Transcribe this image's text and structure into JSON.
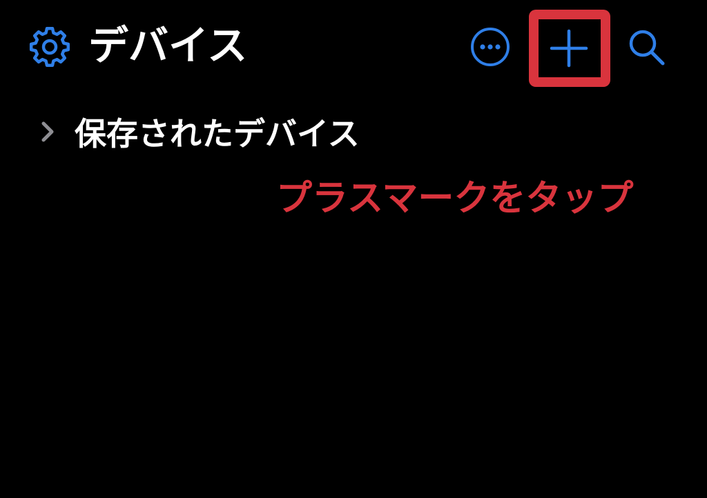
{
  "header": {
    "title": "デバイス",
    "icons": {
      "settings": "gear-icon",
      "more": "ellipsis-circle-icon",
      "add": "plus-icon",
      "search": "search-icon"
    }
  },
  "list": {
    "saved_devices_label": "保存されたデバイス",
    "chevron": "chevron-right-icon"
  },
  "annotation": {
    "callout_text": "プラスマークをタップ",
    "highlight_target": "plus-icon"
  },
  "colors": {
    "background": "#000000",
    "accent": "#2f7fe8",
    "text": "#ffffff",
    "chevron": "#8e8e93",
    "annotation": "#d9343d"
  }
}
